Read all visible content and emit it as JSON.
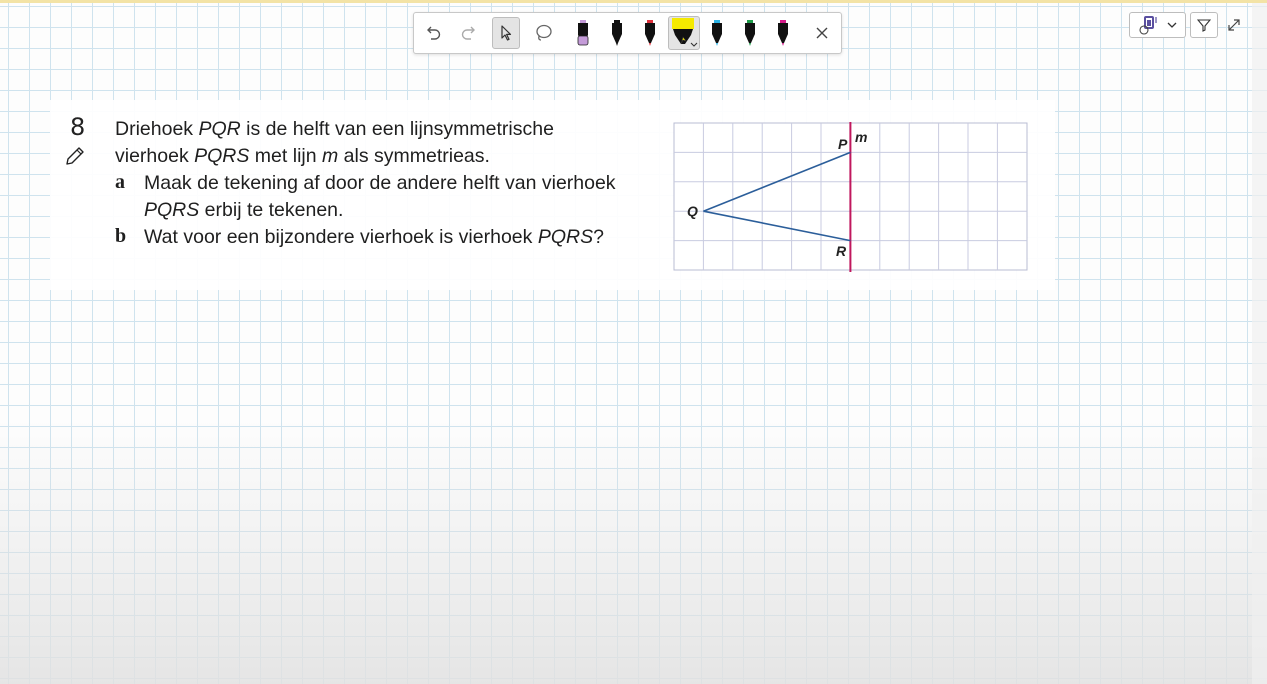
{
  "toolbar": {
    "tools": [
      {
        "name": "undo",
        "icon": "undo-icon"
      },
      {
        "name": "redo",
        "icon": "redo-icon"
      },
      {
        "name": "select",
        "icon": "cursor-icon",
        "active": true
      },
      {
        "name": "lasso",
        "icon": "lasso-icon"
      },
      {
        "name": "pen-lilac",
        "icon": "marker-icon",
        "color": "#c49bd8"
      },
      {
        "name": "pen-black",
        "icon": "marker-icon",
        "color": "#111111"
      },
      {
        "name": "pen-red",
        "icon": "marker-icon",
        "color": "#e0323c"
      },
      {
        "name": "highlighter-yellow",
        "icon": "highlighter-icon",
        "color": "#f5ea00",
        "selected": true
      },
      {
        "name": "pen-blue",
        "icon": "marker-icon",
        "color": "#2bb3e6"
      },
      {
        "name": "pen-green",
        "icon": "marker-icon",
        "color": "#1f9d4a"
      },
      {
        "name": "pen-magenta",
        "icon": "marker-icon",
        "color": "#d61c8a"
      },
      {
        "name": "close",
        "icon": "close-icon"
      }
    ]
  },
  "top_right": {
    "icons": [
      "tool-menu-icon",
      "chevron-down-icon",
      "funnel-icon",
      "expand-icon"
    ]
  },
  "exercise": {
    "number": "8",
    "intro_1": "Driehoek ",
    "intro_pqr": "PQR",
    "intro_2": " is de helft van een lijnsymmetrische",
    "intro_3": "vierhoek ",
    "intro_pqrs": "PQRS",
    "intro_4": " met lijn ",
    "intro_m": "m",
    "intro_5": " als symmetrieas.",
    "a_label": "a",
    "a_text_1": "Maak de tekening af door de andere helft van vierhoek",
    "a_text_pqrs": "PQRS",
    "a_text_2": " erbij te tekenen.",
    "b_label": "b",
    "b_text_1": "Wat voor een bijzondere vierhoek is vierhoek ",
    "b_text_pqrs": "PQRS",
    "b_text_2": "?"
  },
  "figure": {
    "labels": {
      "p": "P",
      "q": "Q",
      "r": "R",
      "m": "m"
    },
    "line_color": "#2b5e9a",
    "axis_color": "#c0175d",
    "grid_color": "#c8cbe0"
  },
  "colors": {
    "grid_line": "#cfe3ee",
    "top_line": "#f3e3a6"
  }
}
